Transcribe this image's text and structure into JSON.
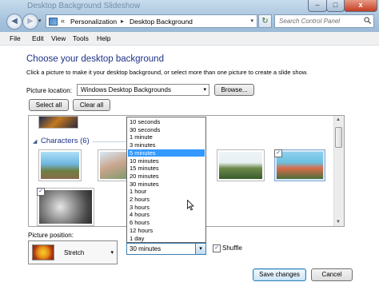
{
  "window": {
    "title": "Desktop Background Slideshow",
    "min": "–",
    "max": "□",
    "close": "x"
  },
  "nav": {
    "back": "◀",
    "forward": "▶",
    "dropdown": "▾",
    "address_sep": "«",
    "breadcrumbs": [
      "Personalization",
      "Desktop Background"
    ],
    "crumb_arrow": "▸",
    "address_dropdown": "▾",
    "refresh": "↻",
    "search_placeholder": "Search Control Panel"
  },
  "menu": [
    "File",
    "Edit",
    "View",
    "Tools",
    "Help"
  ],
  "page": {
    "heading": "Choose your desktop background",
    "subtext": "Click a picture to make it your desktop background, or select more than one picture to create a slide show.",
    "picture_location_label": "Picture location:",
    "picture_location_value": "Windows Desktop Backgrounds",
    "browse": "Browse...",
    "select_all": "Select all",
    "clear_all": "Clear all",
    "category": "Characters (6)",
    "category_toggle": "◢",
    "picture_position_label": "Picture position:",
    "picture_position_value": "Stretch",
    "interval_value": "30 minutes",
    "shuffle_label": "Shuffle",
    "shuffle_checked": "✓",
    "save": "Save changes",
    "cancel": "Cancel",
    "check": "✓",
    "arrow_down": "▾",
    "scroll_up": "▲",
    "scroll_down": "▼"
  },
  "interval_options": [
    "10 seconds",
    "30 seconds",
    "1 minute",
    "3 minutes",
    "5 minutes",
    "10 minutes",
    "15 minutes",
    "20 minutes",
    "30 minutes",
    "1 hour",
    "2 hours",
    "3 hours",
    "4 hours",
    "6 hours",
    "12 hours",
    "1 day"
  ],
  "interval_highlighted": "5 minutes"
}
